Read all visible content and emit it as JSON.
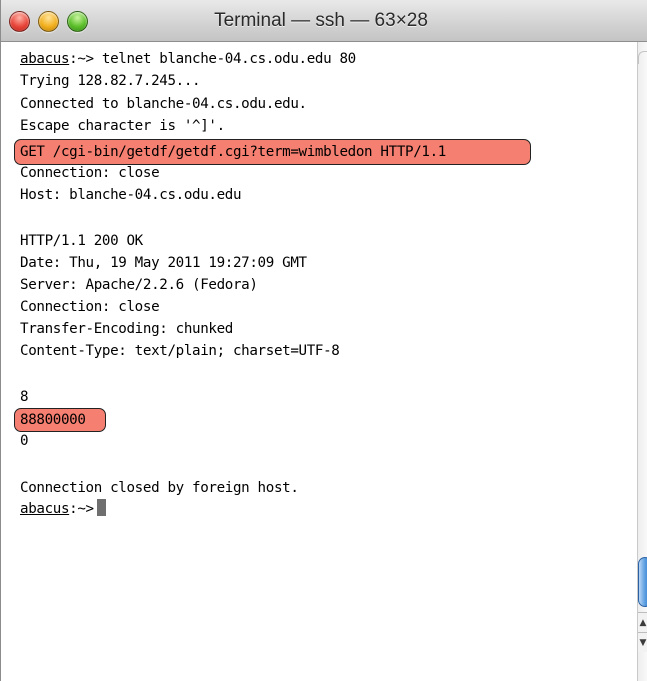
{
  "window": {
    "title": "Terminal — ssh — 63×28"
  },
  "colors": {
    "highlight": "#f57f70",
    "scroll_thumb": "#5a9de0"
  },
  "terminal": {
    "prompt_host": "abacus",
    "prompt_suffix": ":~>",
    "command": " telnet blanche-04.cs.odu.edu 80",
    "lines": [
      "Trying 128.82.7.245...",
      "Connected to blanche-04.cs.odu.edu.",
      "Escape character is '^]'.",
      "GET /cgi-bin/getdf/getdf.cgi?term=wimbledon HTTP/1.1",
      "Connection: close",
      "Host: blanche-04.cs.odu.edu",
      "",
      "HTTP/1.1 200 OK",
      "Date: Thu, 19 May 2011 19:27:09 GMT",
      "Server: Apache/2.2.6 (Fedora)",
      "Connection: close",
      "Transfer-Encoding: chunked",
      "Content-Type: text/plain; charset=UTF-8",
      "",
      "8",
      "88800000",
      "0",
      "",
      "Connection closed by foreign host."
    ]
  }
}
